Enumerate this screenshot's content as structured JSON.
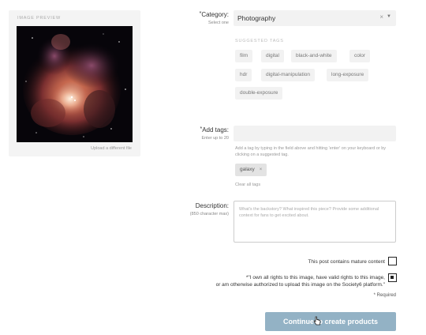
{
  "preview": {
    "label": "IMAGE PREVIEW",
    "upload_link": "Upload a different file"
  },
  "category": {
    "label": "Category:",
    "sublabel": "Select one",
    "value": "Photography",
    "clear_icon": "close-icon",
    "caret_icon": "chevron-down-icon"
  },
  "suggested": {
    "label": "SUGGESTED TAGS",
    "tags": [
      "film",
      "digital",
      "black-and-white",
      "color",
      "hdr",
      "digital-manipulation",
      "long-exposure",
      "double-exposure"
    ]
  },
  "tags": {
    "label": "Add tags:",
    "sublabel": "Enter up to 20",
    "help": "Add a tag by typing in the field above and hitting 'enter' on your keyboard or by clicking on a suggested tag.",
    "current": [
      {
        "text": "galaxy",
        "remove": "×"
      }
    ],
    "clear_link": "Clear all tags"
  },
  "description": {
    "label": "Description:",
    "sublabel": "(850 character max)",
    "placeholder": "What's the backstory? What inspired this piece? Provide some additional context for fans to get excited about."
  },
  "mature": {
    "text": "This post contains mature content",
    "checked": false
  },
  "rights": {
    "line1": "*\"I own all rights to this image, have valid rights to this image,",
    "line2": "or am otherwise authorized to upload this image on the Society6 platform.\"",
    "checked": true
  },
  "required": "* Required",
  "continue_button": "Continue to create products",
  "colors": {
    "button": "#93b2c5",
    "input_bg": "#f2f2f2"
  }
}
